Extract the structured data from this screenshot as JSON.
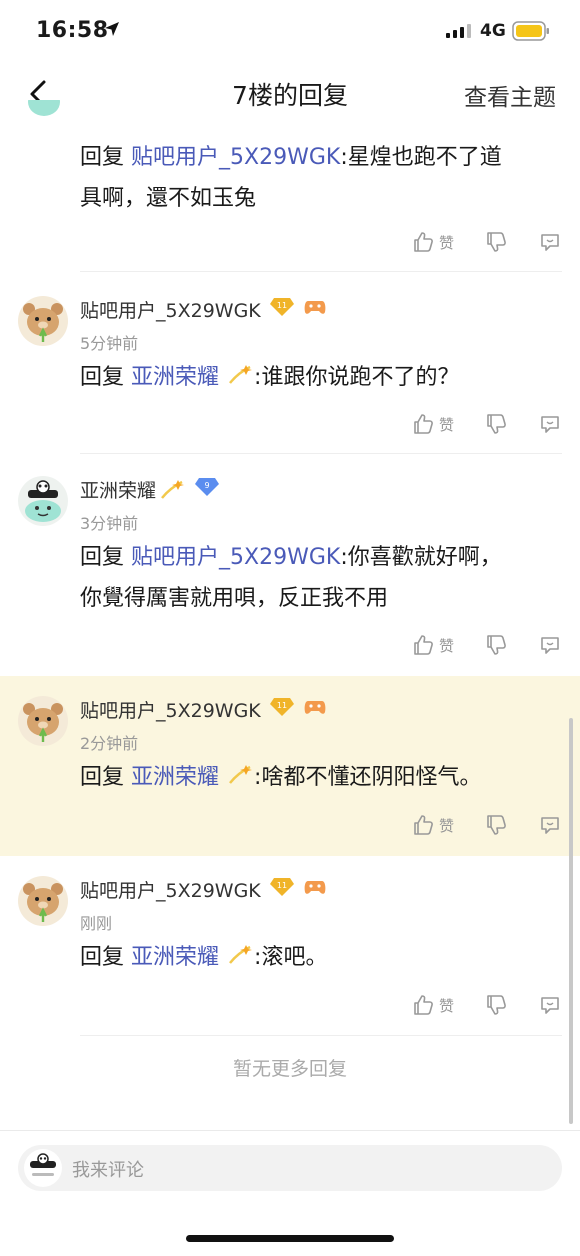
{
  "status_bar": {
    "time": "16:58",
    "network": "4G"
  },
  "nav": {
    "title": "7楼的回复",
    "right_link": "查看主题"
  },
  "first_comment": {
    "reply_prefix": "回复",
    "mention": "贴吧用户_5X29WGK",
    "line1_suffix": ":星煌也跑不了道",
    "line2": "具啊，還不如玉兔"
  },
  "comments": [
    {
      "username": "贴吧用户_5X29WGK",
      "level": "11",
      "time": "5分钟前",
      "reply_prefix": "回复",
      "mention": "亚洲荣耀",
      "text": ":谁跟你说跑不了的？"
    },
    {
      "username": "亚洲荣耀",
      "level": "9",
      "time": "3分钟前",
      "reply_prefix": "回复",
      "mention": "贴吧用户_5X29WGK",
      "line1_suffix": ":你喜歡就好啊，",
      "line2": "你覺得厲害就用唄，反正我不用"
    },
    {
      "username": "贴吧用户_5X29WGK",
      "level": "11",
      "time": "2分钟前",
      "reply_prefix": "回复",
      "mention": "亚洲荣耀",
      "text": ":啥都不懂还阴阳怪气。"
    },
    {
      "username": "贴吧用户_5X29WGK",
      "level": "11",
      "time": "刚刚",
      "reply_prefix": "回复",
      "mention": "亚洲荣耀",
      "text": ":滚吧。"
    }
  ],
  "actions": {
    "like_label": "赞"
  },
  "footer": {
    "no_more": "暂无更多回复"
  },
  "input": {
    "placeholder": "我来评论"
  },
  "colors": {
    "mention": "#4a5ab8",
    "highlight_bg": "#fbf6df",
    "battery": "#f5c518",
    "level_badge": "#f0b429",
    "level9_badge": "#5b8def"
  }
}
